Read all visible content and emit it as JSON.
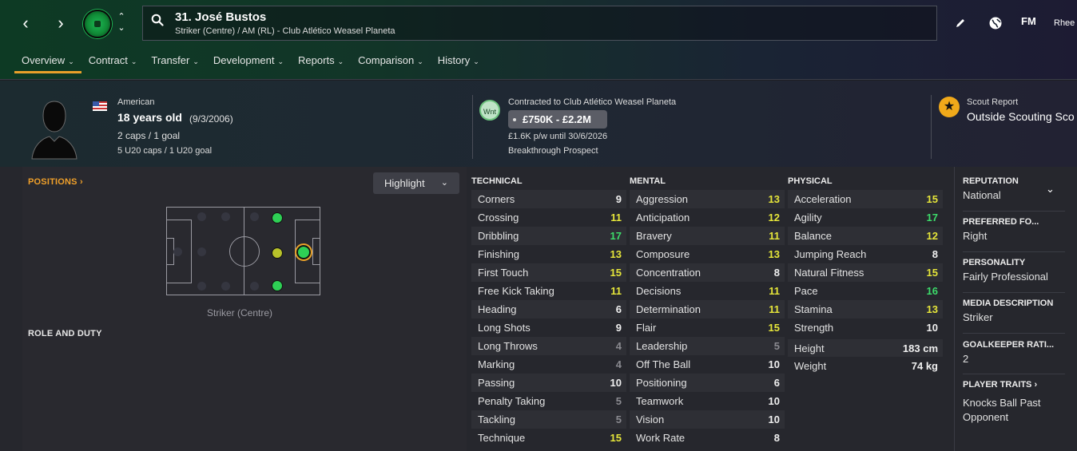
{
  "header": {
    "player_title": "31. José Bustos",
    "player_subtitle": "Striker (Centre) / AM (RL) - Club Atlético Weasel Planeta",
    "back_icon": "‹",
    "forward_icon": "›",
    "fm_label": "FM",
    "user_label": "Rhee"
  },
  "tabs": [
    {
      "label": "Overview",
      "active": true
    },
    {
      "label": "Contract"
    },
    {
      "label": "Transfer"
    },
    {
      "label": "Development"
    },
    {
      "label": "Reports"
    },
    {
      "label": "Comparison"
    },
    {
      "label": "History"
    }
  ],
  "profile": {
    "nationality": "American",
    "age": "18 years old",
    "dob": "(9/3/2006)",
    "caps": "2 caps / 1 goal",
    "youth_caps": "5 U20 caps / 1 U20 goal"
  },
  "contract": {
    "badge": "Wnt",
    "contracted_to": "Contracted to Club Atlético Weasel Planeta",
    "value": "£750K - £2.2M",
    "wage": "£1.6K p/w until 30/6/2026",
    "status": "Breakthrough Prospect"
  },
  "scout": {
    "label": "Scout Report",
    "value": "Outside Scouting Sco"
  },
  "positions": {
    "title": "POSITIONS",
    "highlight_label": "Highlight",
    "caption": "Striker (Centre)",
    "role_title": "ROLE AND DUTY"
  },
  "technical": {
    "title": "TECHNICAL",
    "items": [
      {
        "name": "Corners",
        "value": "9",
        "color": "w"
      },
      {
        "name": "Crossing",
        "value": "11",
        "color": "y"
      },
      {
        "name": "Dribbling",
        "value": "17",
        "color": "gr"
      },
      {
        "name": "Finishing",
        "value": "13",
        "color": "y"
      },
      {
        "name": "First Touch",
        "value": "15",
        "color": "y"
      },
      {
        "name": "Free Kick Taking",
        "value": "11",
        "color": "y"
      },
      {
        "name": "Heading",
        "value": "6",
        "color": "w"
      },
      {
        "name": "Long Shots",
        "value": "9",
        "color": "w"
      },
      {
        "name": "Long Throws",
        "value": "4",
        "color": "g"
      },
      {
        "name": "Marking",
        "value": "4",
        "color": "g"
      },
      {
        "name": "Passing",
        "value": "10",
        "color": "w"
      },
      {
        "name": "Penalty Taking",
        "value": "5",
        "color": "g"
      },
      {
        "name": "Tackling",
        "value": "5",
        "color": "g"
      },
      {
        "name": "Technique",
        "value": "15",
        "color": "y"
      }
    ]
  },
  "mental": {
    "title": "MENTAL",
    "items": [
      {
        "name": "Aggression",
        "value": "13",
        "color": "y"
      },
      {
        "name": "Anticipation",
        "value": "12",
        "color": "y"
      },
      {
        "name": "Bravery",
        "value": "11",
        "color": "y"
      },
      {
        "name": "Composure",
        "value": "13",
        "color": "y"
      },
      {
        "name": "Concentration",
        "value": "8",
        "color": "w"
      },
      {
        "name": "Decisions",
        "value": "11",
        "color": "y"
      },
      {
        "name": "Determination",
        "value": "11",
        "color": "y"
      },
      {
        "name": "Flair",
        "value": "15",
        "color": "y"
      },
      {
        "name": "Leadership",
        "value": "5",
        "color": "g"
      },
      {
        "name": "Off The Ball",
        "value": "10",
        "color": "w"
      },
      {
        "name": "Positioning",
        "value": "6",
        "color": "w"
      },
      {
        "name": "Teamwork",
        "value": "10",
        "color": "w"
      },
      {
        "name": "Vision",
        "value": "10",
        "color": "w"
      },
      {
        "name": "Work Rate",
        "value": "8",
        "color": "w"
      }
    ]
  },
  "physical": {
    "title": "PHYSICAL",
    "items": [
      {
        "name": "Acceleration",
        "value": "15",
        "color": "y"
      },
      {
        "name": "Agility",
        "value": "17",
        "color": "gr"
      },
      {
        "name": "Balance",
        "value": "12",
        "color": "y"
      },
      {
        "name": "Jumping Reach",
        "value": "8",
        "color": "w"
      },
      {
        "name": "Natural Fitness",
        "value": "15",
        "color": "y"
      },
      {
        "name": "Pace",
        "value": "16",
        "color": "gr"
      },
      {
        "name": "Stamina",
        "value": "13",
        "color": "y"
      },
      {
        "name": "Strength",
        "value": "10",
        "color": "w"
      }
    ],
    "height_label": "Height",
    "height_value": "183 cm",
    "weight_label": "Weight",
    "weight_value": "74 kg"
  },
  "sidebar": {
    "reputation_label": "REPUTATION",
    "reputation_value": "National",
    "foot_label": "PREFERRED FO...",
    "foot_value": "Right",
    "personality_label": "PERSONALITY",
    "personality_value": "Fairly Professional",
    "media_label": "MEDIA DESCRIPTION",
    "media_value": "Striker",
    "gk_label": "GOALKEEPER RATI...",
    "gk_value": "2",
    "traits_label": "PLAYER TRAITS",
    "traits_value": "Knocks Ball Past Opponent"
  },
  "colors": {
    "accent": "#e9a02a",
    "grey_value": "#8a8a90",
    "yellow_value": "#e6e63a",
    "green_value": "#3ddc6a"
  }
}
